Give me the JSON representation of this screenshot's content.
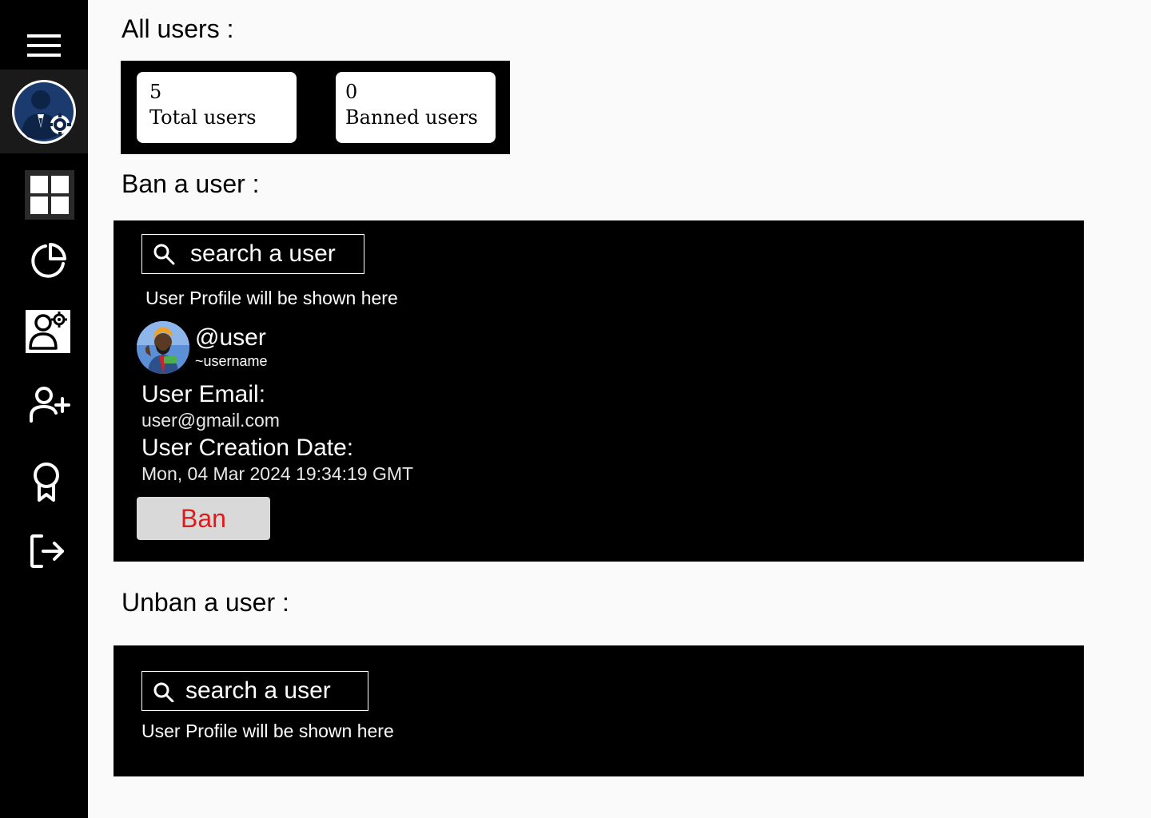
{
  "sidebar": {
    "items": [
      {
        "name": "menu-icon"
      },
      {
        "name": "admin-avatar"
      },
      {
        "name": "dashboard-icon"
      },
      {
        "name": "pie-chart-icon"
      },
      {
        "name": "user-settings-icon"
      },
      {
        "name": "add-user-icon"
      },
      {
        "name": "award-icon"
      },
      {
        "name": "logout-icon"
      }
    ]
  },
  "all_users": {
    "title": "All users :",
    "total": {
      "value": "5",
      "label": "Total users"
    },
    "banned": {
      "value": "0",
      "label": "Banned users"
    }
  },
  "ban": {
    "title": "Ban a user :",
    "search_placeholder": "search a user",
    "hint": "User Profile will be shown here",
    "profile": {
      "handle": "@user",
      "username": "~username",
      "email_label": "User Email:",
      "email": "user@gmail.com",
      "date_label": "User Creation Date:",
      "date": "Mon, 04 Mar 2024 19:34:19 GMT"
    },
    "button_label": "Ban"
  },
  "unban": {
    "title": "Unban a user :",
    "search_placeholder": "search a user",
    "hint": "User Profile will be shown here"
  },
  "colors": {
    "sidebar_bg": "#000000",
    "page_bg": "#fafafa",
    "ban_text": "#e01b1b",
    "ban_button_bg": "#d9d9d9"
  }
}
